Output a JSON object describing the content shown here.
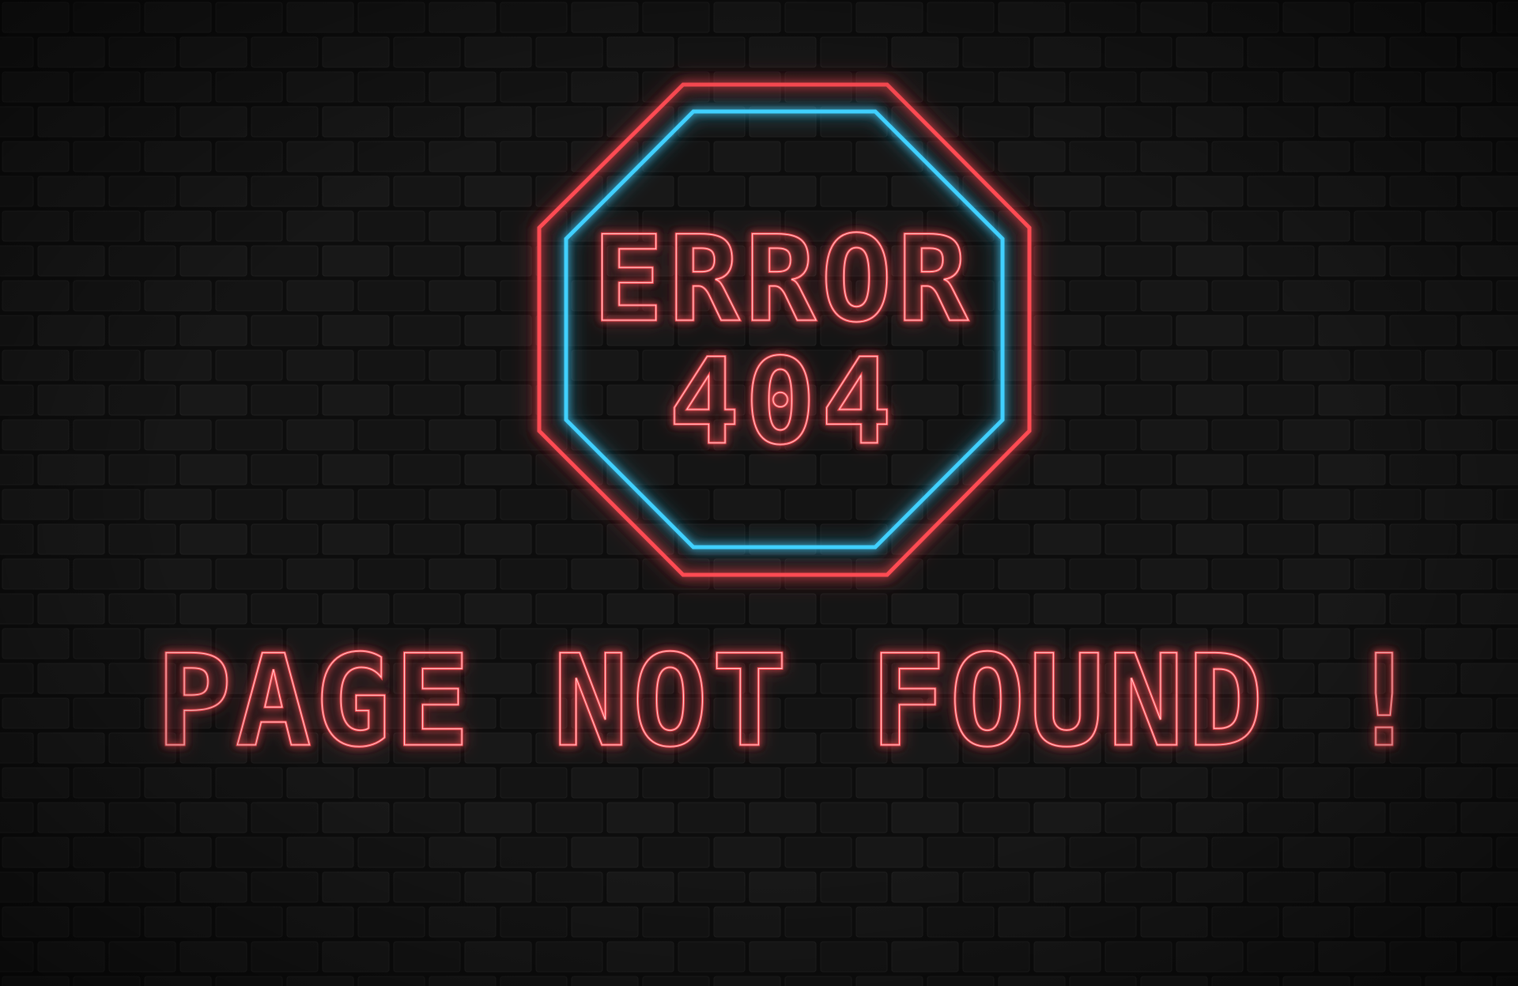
{
  "sign": {
    "line1": "ERROR",
    "line2": "404",
    "message": "PAGE NOT FOUND !"
  },
  "colors": {
    "background": "#0c0c0c",
    "neon_red": "#ff4b52",
    "neon_blue": "#3fd0ff"
  }
}
